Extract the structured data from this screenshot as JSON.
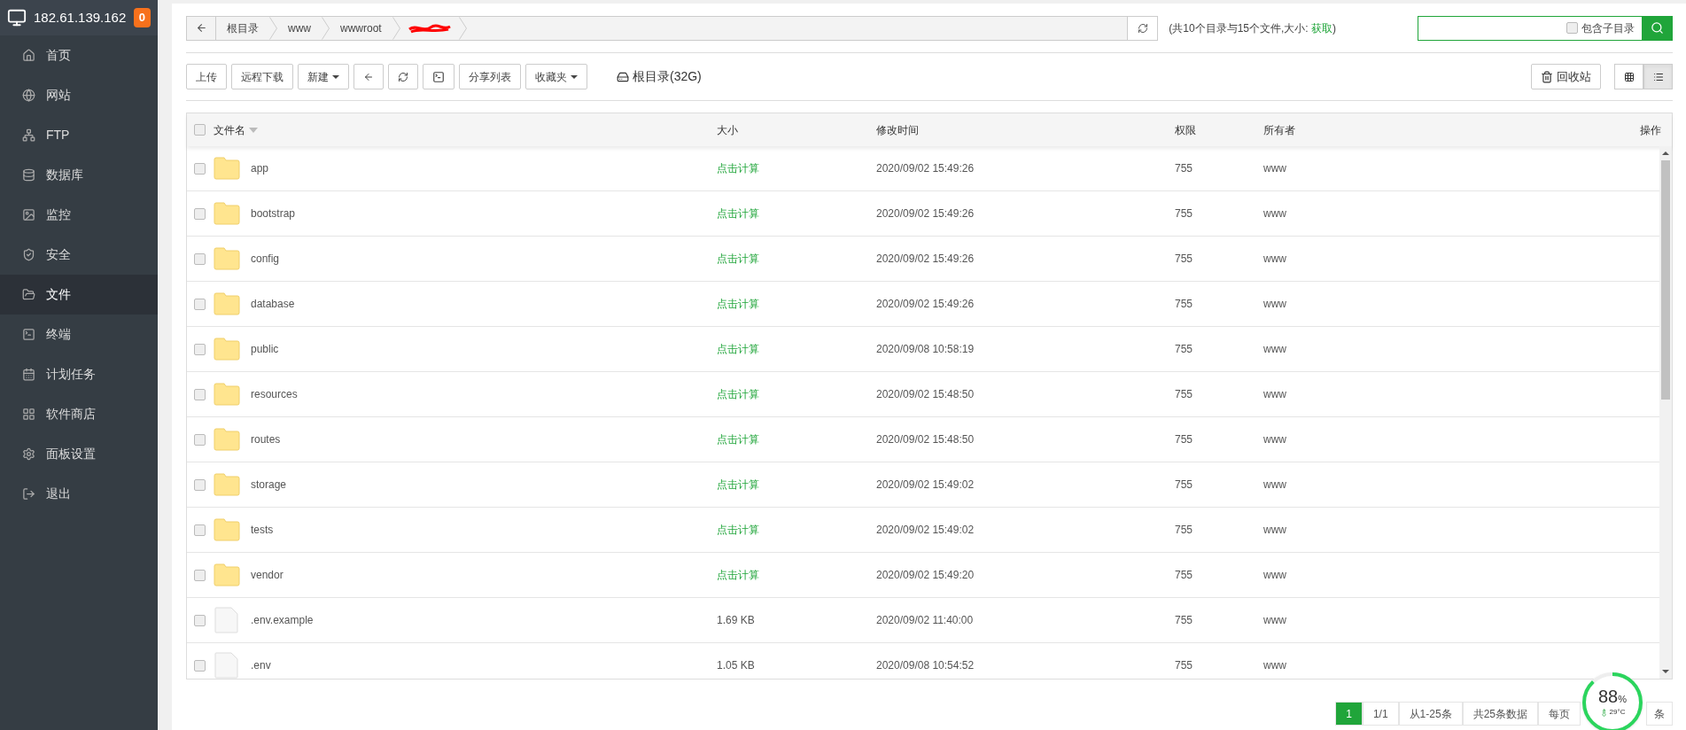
{
  "sidebar": {
    "host": "182.61.139.162",
    "badge": "0",
    "items": [
      {
        "label": "首页",
        "selected": false
      },
      {
        "label": "网站",
        "selected": false
      },
      {
        "label": "FTP",
        "selected": false
      },
      {
        "label": "数据库",
        "selected": false
      },
      {
        "label": "监控",
        "selected": false
      },
      {
        "label": "安全",
        "selected": false
      },
      {
        "label": "文件",
        "selected": true
      },
      {
        "label": "终端",
        "selected": false
      },
      {
        "label": "计划任务",
        "selected": false
      },
      {
        "label": "软件商店",
        "selected": false
      },
      {
        "label": "面板设置",
        "selected": false
      },
      {
        "label": "退出",
        "selected": false
      }
    ]
  },
  "breadcrumb": [
    "根目录",
    "www",
    "wwwroot"
  ],
  "summary": {
    "text": "(共10个目录与15个文件,大小: ",
    "link": "获取",
    "end": ")"
  },
  "search": {
    "checkbox_label": "包含子目录",
    "checked": false
  },
  "toolbar": [
    {
      "kind": "text",
      "label": "上传"
    },
    {
      "kind": "text",
      "label": "远程下载"
    },
    {
      "kind": "dropdown",
      "label": "新建"
    },
    {
      "kind": "back"
    },
    {
      "kind": "refresh"
    },
    {
      "kind": "terminal"
    },
    {
      "kind": "text",
      "label": "分享列表"
    },
    {
      "kind": "dropdown",
      "label": "收藏夹"
    }
  ],
  "disk": "根目录(32G)",
  "recycle": "回收站",
  "views": [
    {
      "kind": "grid",
      "selected": false
    },
    {
      "kind": "list",
      "selected": true
    }
  ],
  "table": {
    "checked": false,
    "columns": [
      "文件名",
      "大小",
      "修改时间",
      "权限",
      "所有者",
      "操作"
    ],
    "rows": [
      {
        "kind": "folder",
        "name": "app",
        "size": "点击计算",
        "time": "2020/09/02 15:49:26",
        "perm": "755",
        "owner": "www",
        "checked": false
      },
      {
        "kind": "folder",
        "name": "bootstrap",
        "size": "点击计算",
        "time": "2020/09/02 15:49:26",
        "perm": "755",
        "owner": "www",
        "checked": false
      },
      {
        "kind": "folder",
        "name": "config",
        "size": "点击计算",
        "time": "2020/09/02 15:49:26",
        "perm": "755",
        "owner": "www",
        "checked": false
      },
      {
        "kind": "folder",
        "name": "database",
        "size": "点击计算",
        "time": "2020/09/02 15:49:26",
        "perm": "755",
        "owner": "www",
        "checked": false
      },
      {
        "kind": "folder",
        "name": "public",
        "size": "点击计算",
        "time": "2020/09/08 10:58:19",
        "perm": "755",
        "owner": "www",
        "checked": false
      },
      {
        "kind": "folder",
        "name": "resources",
        "size": "点击计算",
        "time": "2020/09/02 15:48:50",
        "perm": "755",
        "owner": "www",
        "checked": false
      },
      {
        "kind": "folder",
        "name": "routes",
        "size": "点击计算",
        "time": "2020/09/02 15:48:50",
        "perm": "755",
        "owner": "www",
        "checked": false
      },
      {
        "kind": "folder",
        "name": "storage",
        "size": "点击计算",
        "time": "2020/09/02 15:49:02",
        "perm": "755",
        "owner": "www",
        "checked": false
      },
      {
        "kind": "folder",
        "name": "tests",
        "size": "点击计算",
        "time": "2020/09/02 15:49:02",
        "perm": "755",
        "owner": "www",
        "checked": false
      },
      {
        "kind": "folder",
        "name": "vendor",
        "size": "点击计算",
        "time": "2020/09/02 15:49:20",
        "perm": "755",
        "owner": "www",
        "checked": false
      },
      {
        "kind": "file",
        "name": ".env.example",
        "size": "1.69 KB",
        "time": "2020/09/02 11:40:00",
        "perm": "755",
        "owner": "www",
        "checked": false
      },
      {
        "kind": "file",
        "name": ".env",
        "size": "1.05 KB",
        "time": "2020/09/08 10:54:52",
        "perm": "755",
        "owner": "www",
        "checked": false
      }
    ]
  },
  "pagination": [
    {
      "label": "1",
      "selected": true
    },
    {
      "label": "1/1",
      "selected": false
    },
    {
      "label": "从1-25条",
      "selected": false
    },
    {
      "label": "共25条数据",
      "selected": false
    },
    {
      "label": "每页",
      "selected": false
    }
  ],
  "pagination_end": "条",
  "gauge": {
    "value": "88",
    "unit": "%",
    "temp": "29°C",
    "level": 0.88
  }
}
